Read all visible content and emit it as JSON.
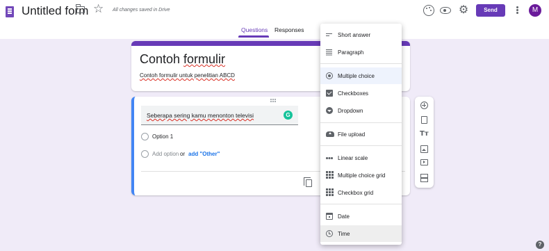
{
  "app": {
    "title": "Untitled form",
    "saved_status": "All changes saved in Drive",
    "send_label": "Send",
    "avatar_initial": "M",
    "brand_color": "#673ab7"
  },
  "tabs": [
    {
      "label": "Questions",
      "active": true
    },
    {
      "label": "Responses",
      "active": false
    }
  ],
  "form": {
    "title_plain": "Contoh ",
    "title_marked": "formulir",
    "description": "Contoh formulir untuk penelitian ABCD"
  },
  "question": {
    "text": "Seberapa sering kamu menonton televisi",
    "grammarly_badge": "G",
    "options": [
      {
        "label": "Option 1"
      }
    ],
    "add_option": "Add option",
    "or": "or",
    "add_other": "add \"Other\""
  },
  "type_menu": {
    "selected": "Multiple choice",
    "items": [
      {
        "label": "Short answer",
        "icon": "short-answer-icon"
      },
      {
        "label": "Paragraph",
        "icon": "paragraph-icon"
      },
      {
        "label": "Multiple choice",
        "icon": "multiple-choice-icon"
      },
      {
        "label": "Checkboxes",
        "icon": "checkboxes-icon"
      },
      {
        "label": "Dropdown",
        "icon": "dropdown-icon"
      },
      {
        "label": "File upload",
        "icon": "file-upload-icon"
      },
      {
        "label": "Linear scale",
        "icon": "linear-scale-icon"
      },
      {
        "label": "Multiple choice grid",
        "icon": "grid-icon"
      },
      {
        "label": "Checkbox grid",
        "icon": "grid-icon"
      },
      {
        "label": "Date",
        "icon": "date-icon"
      },
      {
        "label": "Time",
        "icon": "time-icon"
      }
    ]
  },
  "toolbar": {
    "items": [
      "add-question-icon",
      "import-questions-icon",
      "add-title-icon",
      "add-image-icon",
      "add-video-icon",
      "add-section-icon"
    ],
    "title_glyph": "Tт"
  },
  "help_glyph": "?"
}
